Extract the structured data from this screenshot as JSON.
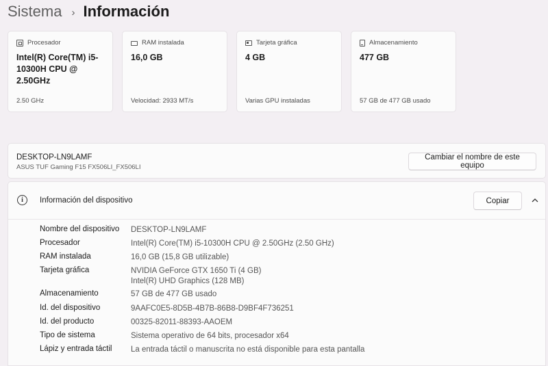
{
  "breadcrumb": {
    "parent": "Sistema",
    "separator": "›",
    "current": "Información"
  },
  "cards": [
    {
      "icon": "processor-icon",
      "label": "Procesador",
      "value": "Intel(R) Core(TM) i5-10300H CPU @ 2.50GHz",
      "sub": "2.50 GHz"
    },
    {
      "icon": "ram-icon",
      "label": "RAM instalada",
      "value": "16,0 GB",
      "sub": "Velocidad: 2933 MT/s"
    },
    {
      "icon": "graphics-card-icon",
      "label": "Tarjeta gráfica",
      "value": "4 GB",
      "sub": "Varias GPU instaladas"
    },
    {
      "icon": "storage-icon",
      "label": "Almacenamiento",
      "value": "477 GB",
      "sub": "57 GB de 477 GB usado"
    }
  ],
  "device": {
    "name": "DESKTOP-LN9LAMF",
    "model": "ASUS TUF Gaming F15 FX506LI_FX506LI",
    "rename_label": "Cambiar el nombre de este equipo"
  },
  "info_panel": {
    "title": "Información del dispositivo",
    "copy_label": "Copiar",
    "specs": [
      {
        "label": "Nombre del dispositivo",
        "values": [
          "DESKTOP-LN9LAMF"
        ]
      },
      {
        "label": "Procesador",
        "values": [
          "Intel(R) Core(TM) i5-10300H CPU @ 2.50GHz (2.50 GHz)"
        ]
      },
      {
        "label": "RAM instalada",
        "values": [
          "16,0 GB (15,8 GB utilizable)"
        ]
      },
      {
        "label": "Tarjeta gráfica",
        "values": [
          "NVIDIA GeForce GTX 1650 Ti (4 GB)",
          "Intel(R) UHD Graphics (128 MB)"
        ]
      },
      {
        "label": "Almacenamiento",
        "values": [
          "57 GB de 477 GB usado"
        ]
      },
      {
        "label": "Id. del dispositivo",
        "values": [
          "9AAFC0E5-8D5B-4B7B-86B8-D9BF4F736251"
        ]
      },
      {
        "label": "Id. del producto",
        "values": [
          "00325-82011-88393-AAOEM"
        ]
      },
      {
        "label": "Tipo de sistema",
        "values": [
          "Sistema operativo de 64 bits, procesador x64"
        ]
      },
      {
        "label": "Lápiz y entrada táctil",
        "values": [
          "La entrada táctil o manuscrita no está disponible para esta pantalla"
        ]
      }
    ]
  }
}
